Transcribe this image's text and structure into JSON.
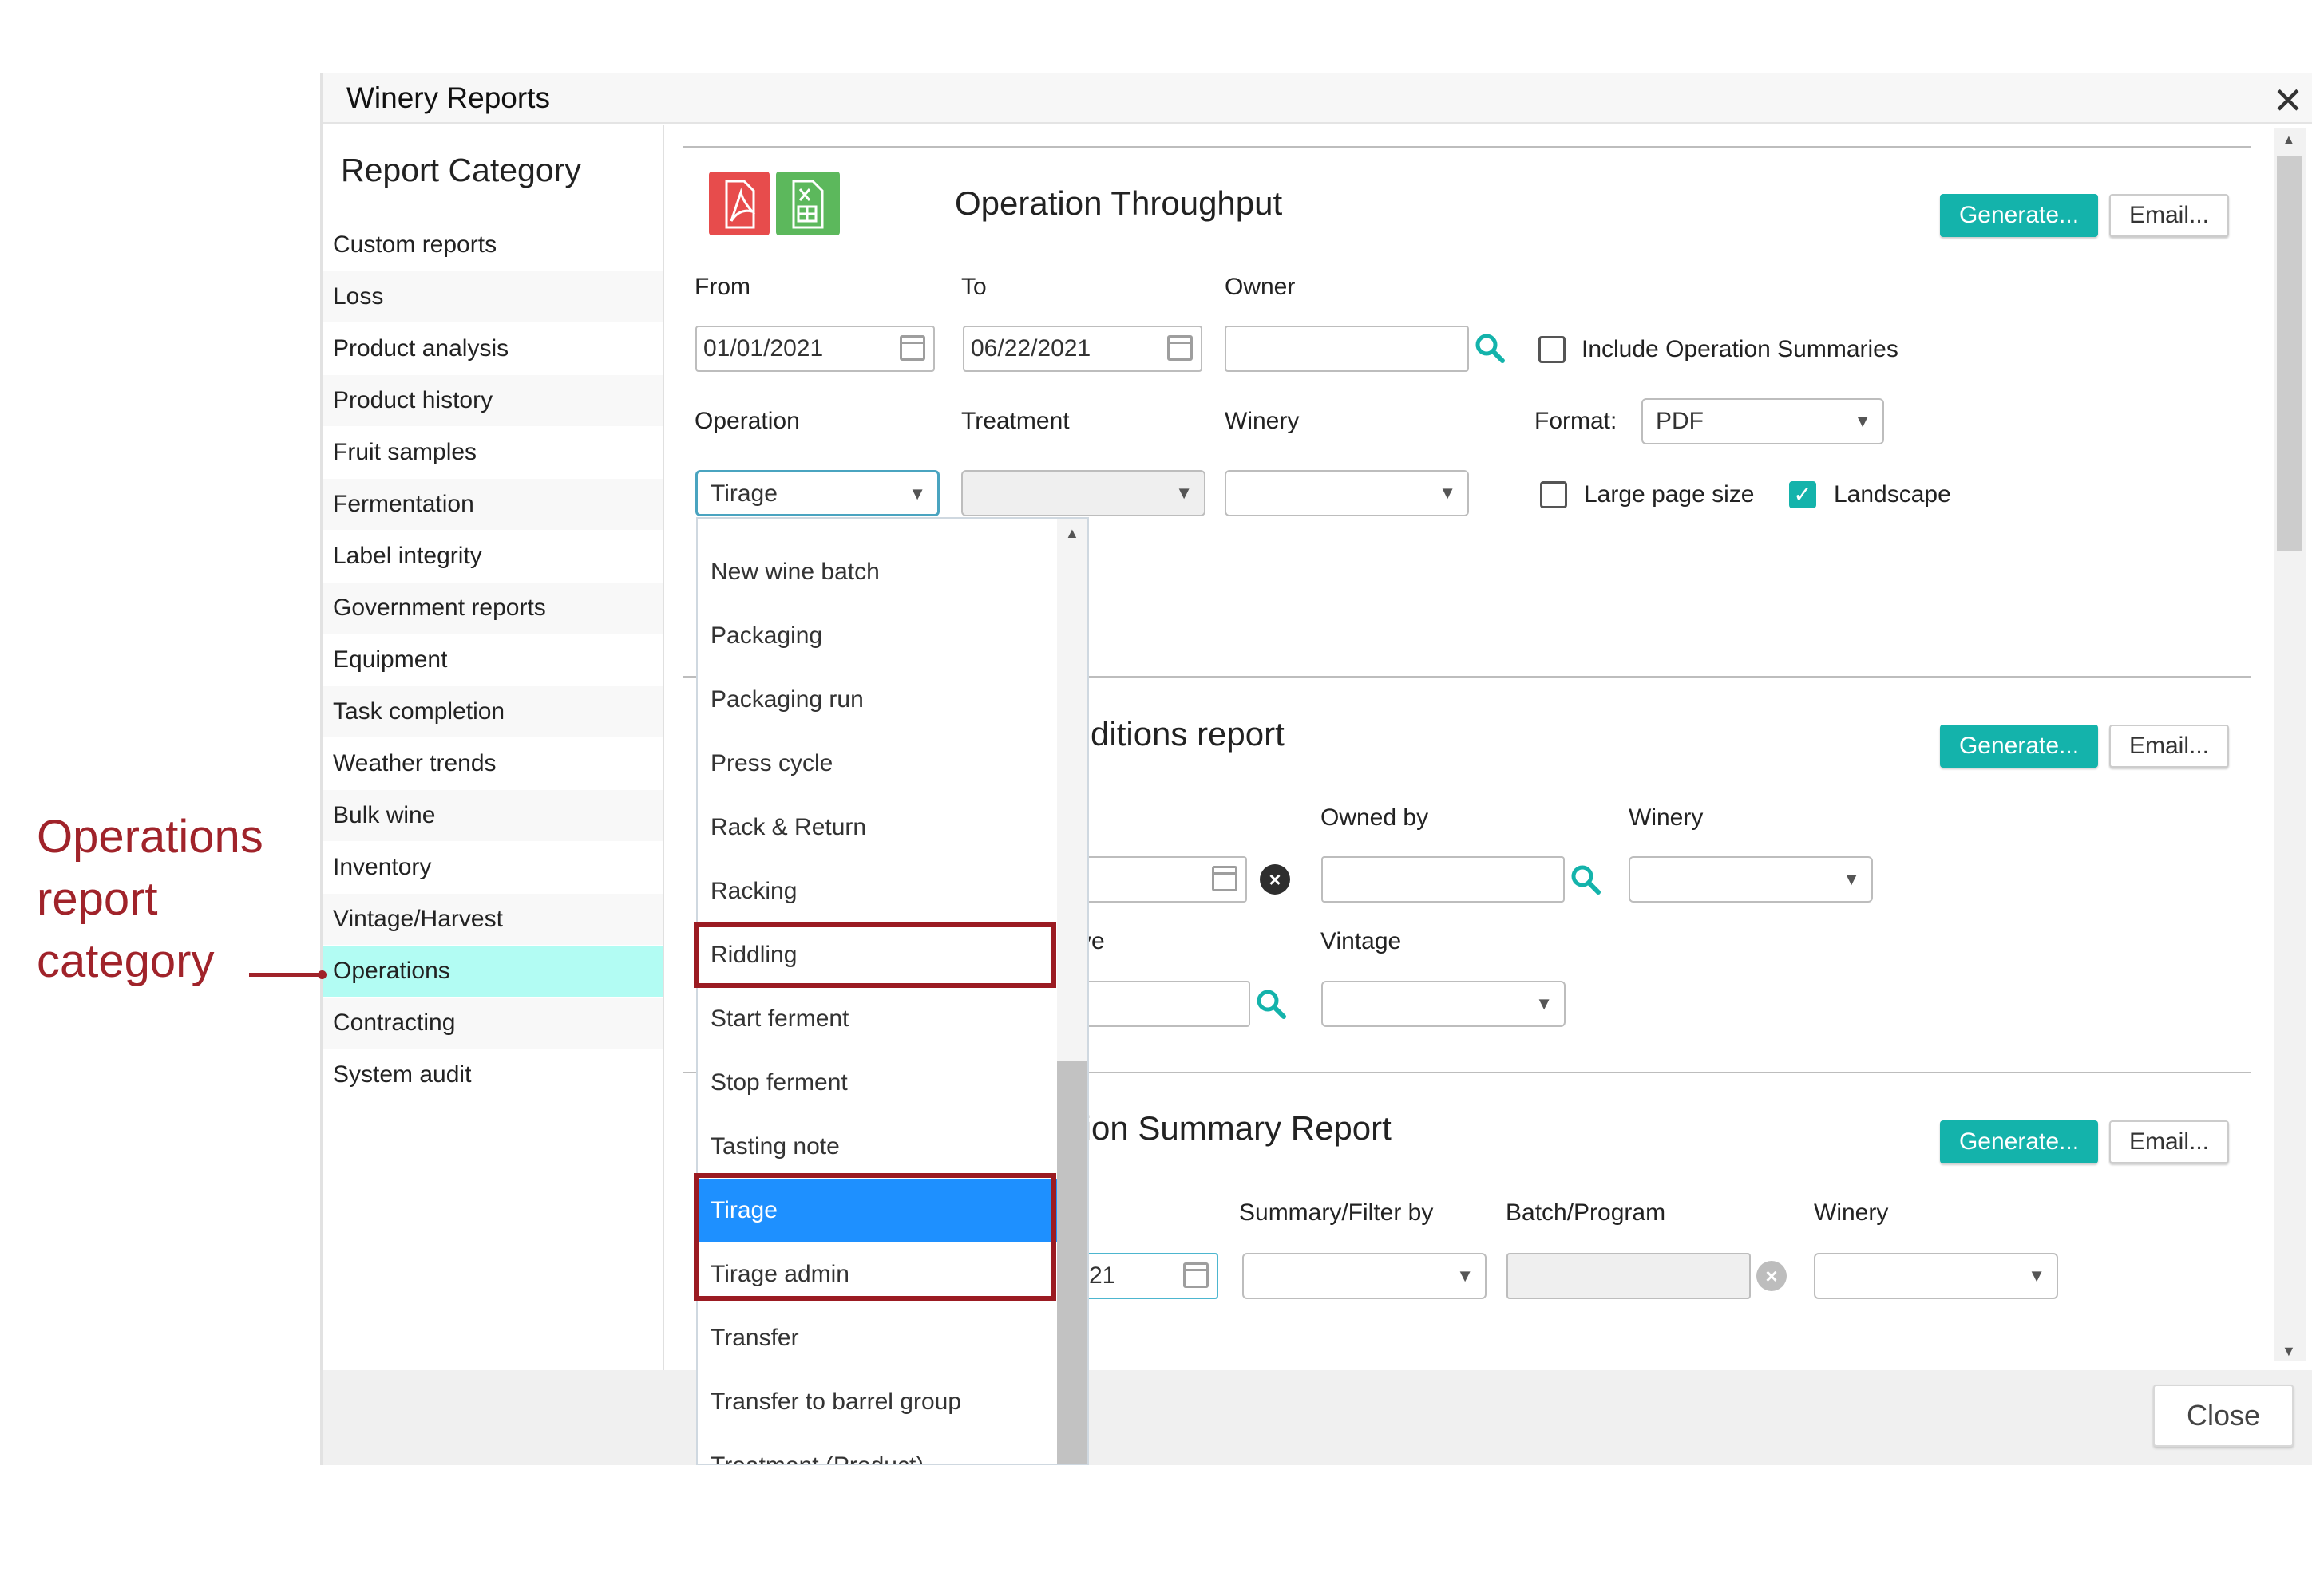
{
  "window": {
    "title": "Winery Reports",
    "close_glyph": "✕"
  },
  "sidebar": {
    "title": "Report Category",
    "items": [
      {
        "label": "Custom reports"
      },
      {
        "label": "Loss"
      },
      {
        "label": "Product analysis"
      },
      {
        "label": "Product history"
      },
      {
        "label": "Fruit samples"
      },
      {
        "label": "Fermentation"
      },
      {
        "label": "Label integrity"
      },
      {
        "label": "Government reports"
      },
      {
        "label": "Equipment"
      },
      {
        "label": "Task completion"
      },
      {
        "label": "Weather trends"
      },
      {
        "label": "Bulk wine"
      },
      {
        "label": "Inventory"
      },
      {
        "label": "Vintage/Harvest"
      },
      {
        "label": "Operations"
      },
      {
        "label": "Contracting"
      },
      {
        "label": "System audit"
      }
    ],
    "active_item": "Operations"
  },
  "report1": {
    "title": "Operation Throughput",
    "icons": [
      "pdf-icon",
      "excel-icon"
    ],
    "generate_label": "Generate...",
    "email_label": "Email...",
    "from_label": "From",
    "from_value": "01/01/2021",
    "to_label": "To",
    "to_value": "06/22/2021",
    "owner_label": "Owner",
    "owner_value": "",
    "include_summaries_label": "Include Operation Summaries",
    "include_summaries_checked": false,
    "operation_label": "Operation",
    "operation_value": "Tirage",
    "treatment_label": "Treatment",
    "treatment_value": "",
    "winery_label": "Winery",
    "winery_value": "",
    "format_label": "Format:",
    "format_value": "PDF",
    "large_page_label": "Large page size",
    "large_page_checked": false,
    "landscape_label": "Landscape",
    "landscape_checked": true
  },
  "report2": {
    "title_visible": "ditions report",
    "generate_label": "Generate...",
    "email_label": "Email...",
    "owned_by_label": "Owned by",
    "winery_label": "Winery",
    "partial_label": "ve",
    "vintage_label": "Vintage"
  },
  "report3": {
    "title_visible": "tion Summary Report",
    "generate_label": "Generate...",
    "email_label": "Email...",
    "summary_label": "Summary/Filter by",
    "batch_label": "Batch/Program",
    "winery_label": "Winery",
    "date_partial": "21"
  },
  "dropdown": {
    "options": [
      {
        "label": "New wine batch"
      },
      {
        "label": "Packaging"
      },
      {
        "label": "Packaging run"
      },
      {
        "label": "Press cycle"
      },
      {
        "label": "Rack & Return"
      },
      {
        "label": "Racking"
      },
      {
        "label": "Riddling"
      },
      {
        "label": "Start ferment"
      },
      {
        "label": "Stop ferment"
      },
      {
        "label": "Tasting note"
      },
      {
        "label": "Tirage"
      },
      {
        "label": "Tirage admin"
      },
      {
        "label": "Transfer"
      },
      {
        "label": "Transfer to barrel group"
      },
      {
        "label": "Treatment (Product)"
      }
    ],
    "selected": "Tirage",
    "highlighted": [
      "Riddling",
      "Tirage",
      "Tirage admin"
    ]
  },
  "footer": {
    "close_label": "Close"
  },
  "annotation": {
    "lines": [
      "Operations",
      "report",
      "category"
    ],
    "color": "#a0232a"
  },
  "colors": {
    "accent": "#14b3ab",
    "active_sidebar": "#b2fcf3",
    "selected_option": "#1e90ff",
    "highlight_box": "#9b1b22"
  }
}
